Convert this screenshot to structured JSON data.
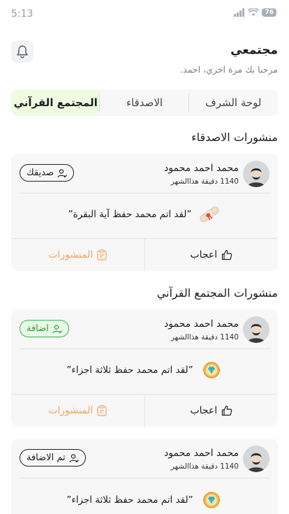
{
  "status_bar": {
    "time": "5:13",
    "battery": "76"
  },
  "header": {
    "title": "مجتمعي",
    "subtitle": "مرحبا بك مرة اخري، احمد."
  },
  "tabs": [
    {
      "label": "لوحة الشرف",
      "active": false
    },
    {
      "label": "الاصدقاء",
      "active": false
    },
    {
      "label": "المجتمع القرآني",
      "active": true
    }
  ],
  "sections": {
    "friends_title": "منشورات الاصدقاء",
    "community_title": "منشورات المجتمع القرآني"
  },
  "cards": [
    {
      "name": "محمد احمد محمود",
      "meta": "1140 دقيقة هذاالشهر",
      "chip": "صديقك",
      "post": "”لقد اتم محمد حفظ آية البقرة”",
      "like": "اعجاب",
      "posts": "المنشورات"
    },
    {
      "name": "محمد احمد محمود",
      "meta": "1140 دقيقة هذاالشهر",
      "chip": "اضافة",
      "post": "”لقد اتم محمد حفظ ثلاثة اجزاء”",
      "like": "اعجاب",
      "posts": "المنشورات"
    },
    {
      "name": "محمد احمد محمود",
      "meta": "1140 دقيقة هذاالشهر",
      "chip": "تم الاضافة",
      "post": "”لقد اتم محمد حفظ ثلاثة اجزاء”"
    }
  ],
  "colors": {
    "accent_green": "#39b54a",
    "active_tab_bg": "#effbe0",
    "posts_orange": "#f2a35d",
    "card_bg": "#f7f7f8"
  }
}
